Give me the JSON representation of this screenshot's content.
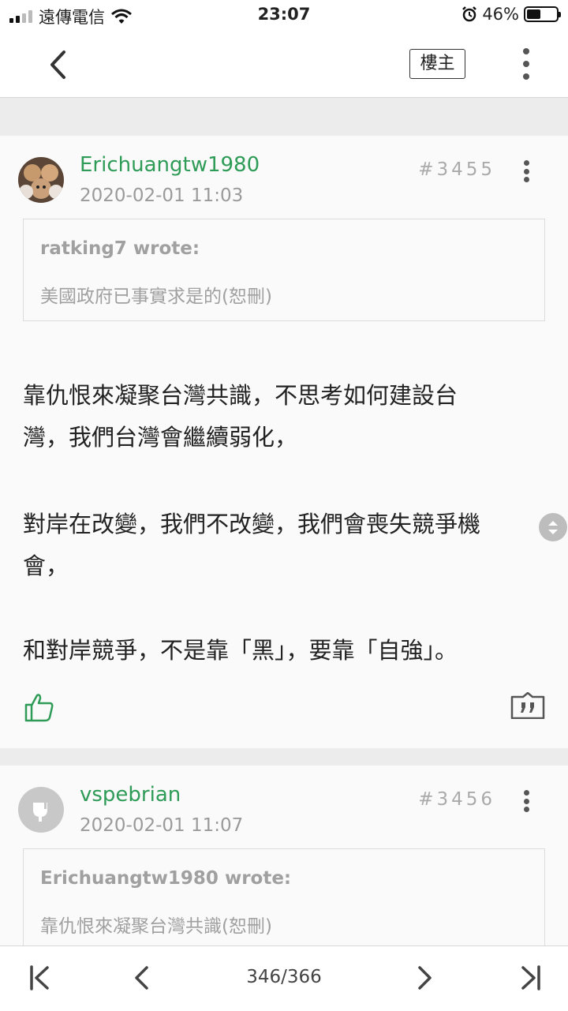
{
  "status_bar": {
    "carrier": "遠傳電信",
    "time": "23:07",
    "battery": "46%",
    "battery_level": 0.46
  },
  "header": {
    "op_label": "樓主",
    "icons": [
      "back-chevron-icon",
      "more-vertical-icon"
    ]
  },
  "posts": [
    {
      "author": "Erichuangtw1980",
      "time": "2020-02-01 11:03",
      "floor": "#3455",
      "quote": {
        "author": "ratking7 wrote:",
        "text": "美國政府已事實求是的(恕刪)"
      },
      "body": [
        "靠仇恨來凝聚台灣共識，不思考如何建設台",
        "灣，我們台灣會繼續弱化，",
        "對岸在改變，我們不改變，我們會喪失競爭機",
        "會，",
        "和對岸競爭，不是靠「黑」，要靠「自強」。"
      ]
    },
    {
      "author": "vspebrian",
      "time": "2020-02-01 11:07",
      "floor": "#3456",
      "quote": {
        "author": "Erichuangtw1980 wrote:",
        "text": "靠仇恨來凝聚台灣共識(恕刪)"
      }
    }
  ],
  "pager": {
    "label": "346/366"
  },
  "colors": {
    "accent": "#2e9b57",
    "muted": "#9a9a9a",
    "background": "#ececec"
  }
}
